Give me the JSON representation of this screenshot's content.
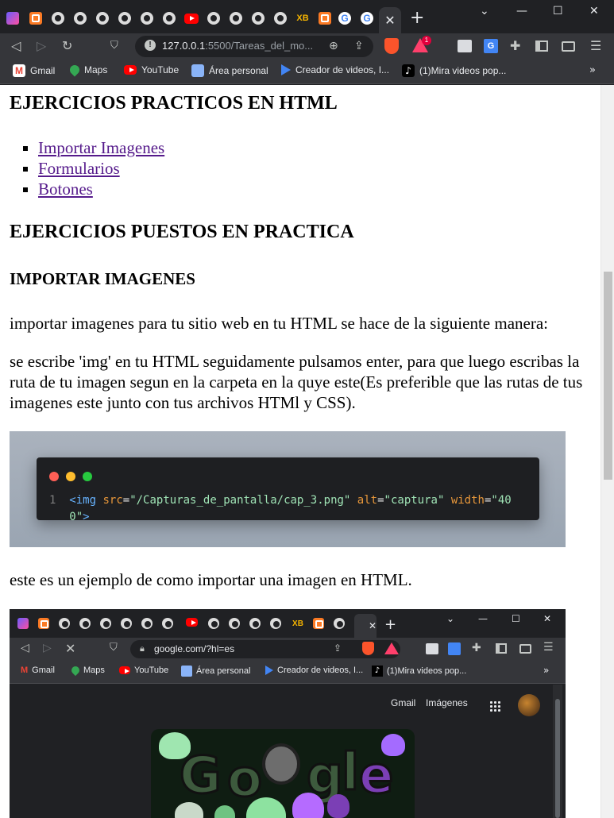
{
  "browser": {
    "active_tab_close": "✕",
    "new_tab": "+",
    "window_controls": {
      "dropdown": "⌄",
      "minimize": "—",
      "maximize": "☐",
      "close": "✕"
    },
    "address": {
      "host": "127.0.0.1",
      "rest": ":5500/Tareas_del_mo..."
    },
    "nav": {
      "back": "◁",
      "forward": "▷",
      "reload": "↻",
      "bookmark": "🔖"
    },
    "bookmarks": [
      {
        "label": "Gmail",
        "icon": "gmail-icon",
        "color": "#ea4335"
      },
      {
        "label": "Maps",
        "icon": "maps-icon",
        "color": "#34a853"
      },
      {
        "label": "YouTube",
        "icon": "youtube-icon",
        "color": "#ff0000"
      },
      {
        "label": "Área personal",
        "icon": "area-personal-icon",
        "color": "#8ab4f8"
      },
      {
        "label": "Creador de videos, I...",
        "icon": "video-creator-icon",
        "color": "#4285f4"
      },
      {
        "label": "(1)Mira videos pop...",
        "icon": "tiktok-icon",
        "color": "#ffffff"
      }
    ],
    "bookmarks_more": "»",
    "bat_badge": "1"
  },
  "page": {
    "heading_main": "EJERCICIOS PRACTICOS EN HTML",
    "links": [
      "Importar Imagenes",
      "Formularios",
      "Botones"
    ],
    "heading_practice": "EJERCICIOS PUESTOS EN PRACTICA",
    "heading_import": "IMPORTAR IMAGENES",
    "para_intro": "importar imagenes para tu sitio web en tu HTML se hace de la siguiente manera:",
    "para_steps": "se escribe 'img' en tu HTML seguidamente pulsamos enter, para que luego escribas la ruta de tu imagen segun en la carpeta en la quye este(Es preferible que las rutas de tus imagenes este junto con tus archivos HTMl y CSS).",
    "para_example": "este es un ejemplo de como importar una imagen en HTML."
  },
  "code_sample": {
    "line_number": "1",
    "open": "<",
    "tag": "img",
    "attr_src": "src",
    "val_src": "\"/Capturas_de_pantalla/cap_3.png\"",
    "attr_alt": "alt",
    "val_alt": "\"captura\"",
    "attr_width": "width",
    "val_width_a": "\"40",
    "val_width_b": "0\"",
    "eq": "=",
    "close": ">",
    "dots": [
      "#ff5f56",
      "#ffbd2e",
      "#27c93f"
    ]
  },
  "nested_screenshot": {
    "url": "google.com/?hl=es",
    "bookmarks": [
      {
        "label": "Gmail"
      },
      {
        "label": "Maps"
      },
      {
        "label": "YouTube"
      },
      {
        "label": "Área personal"
      },
      {
        "label": "Creador de videos, I..."
      },
      {
        "label": "(1)Mira videos pop..."
      }
    ],
    "header_links": [
      "Gmail",
      "Imágenes"
    ]
  }
}
